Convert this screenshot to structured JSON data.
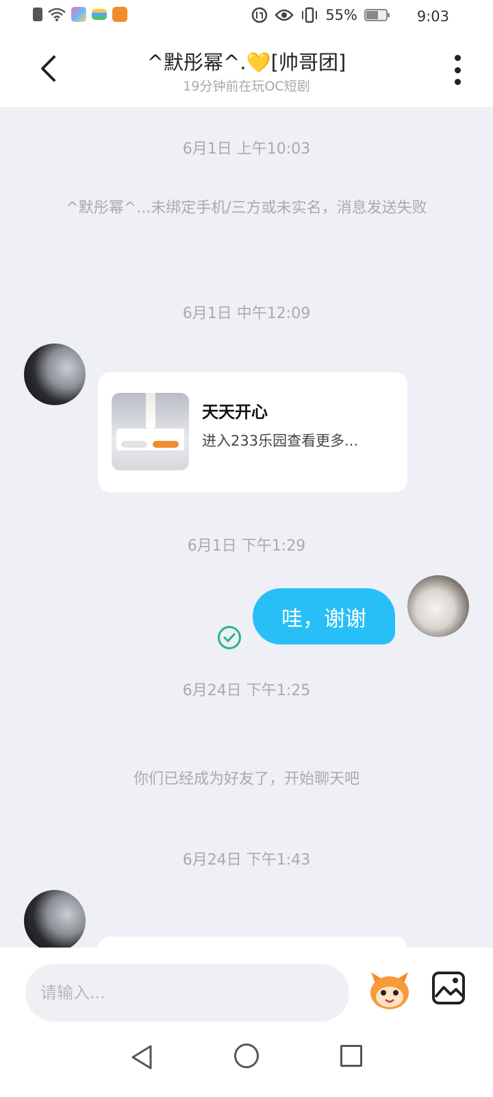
{
  "status_bar": {
    "battery_text": "55%",
    "time": "9:03"
  },
  "header": {
    "back_icon": "chevron-left-icon",
    "title": "^默彤幂^.💛[帅哥团]",
    "subtitle": "19分钟前在玩OC短剧",
    "more_icon": "more-vertical-icon"
  },
  "messages": {
    "ts1": "6月1日 上午10:03",
    "system1": "^默彤幂^...未绑定手机/三方或未实名，消息发送失败",
    "ts2": "6月1日 中午12:09",
    "card": {
      "title": "天天开心",
      "description": "进入233乐园查看更多..."
    },
    "ts3": "6月1日 下午1:29",
    "sent_text": "哇，谢谢",
    "ts4": "6月24日 下午1:25",
    "system2": "你们已经成为好友了，开始聊天吧",
    "ts5": "6月24日 下午1:43"
  },
  "input": {
    "placeholder": "请输入..."
  },
  "colors": {
    "accent": "#27bff6",
    "chat_bg": "#eef0f6",
    "check_green": "#2ab38a"
  }
}
